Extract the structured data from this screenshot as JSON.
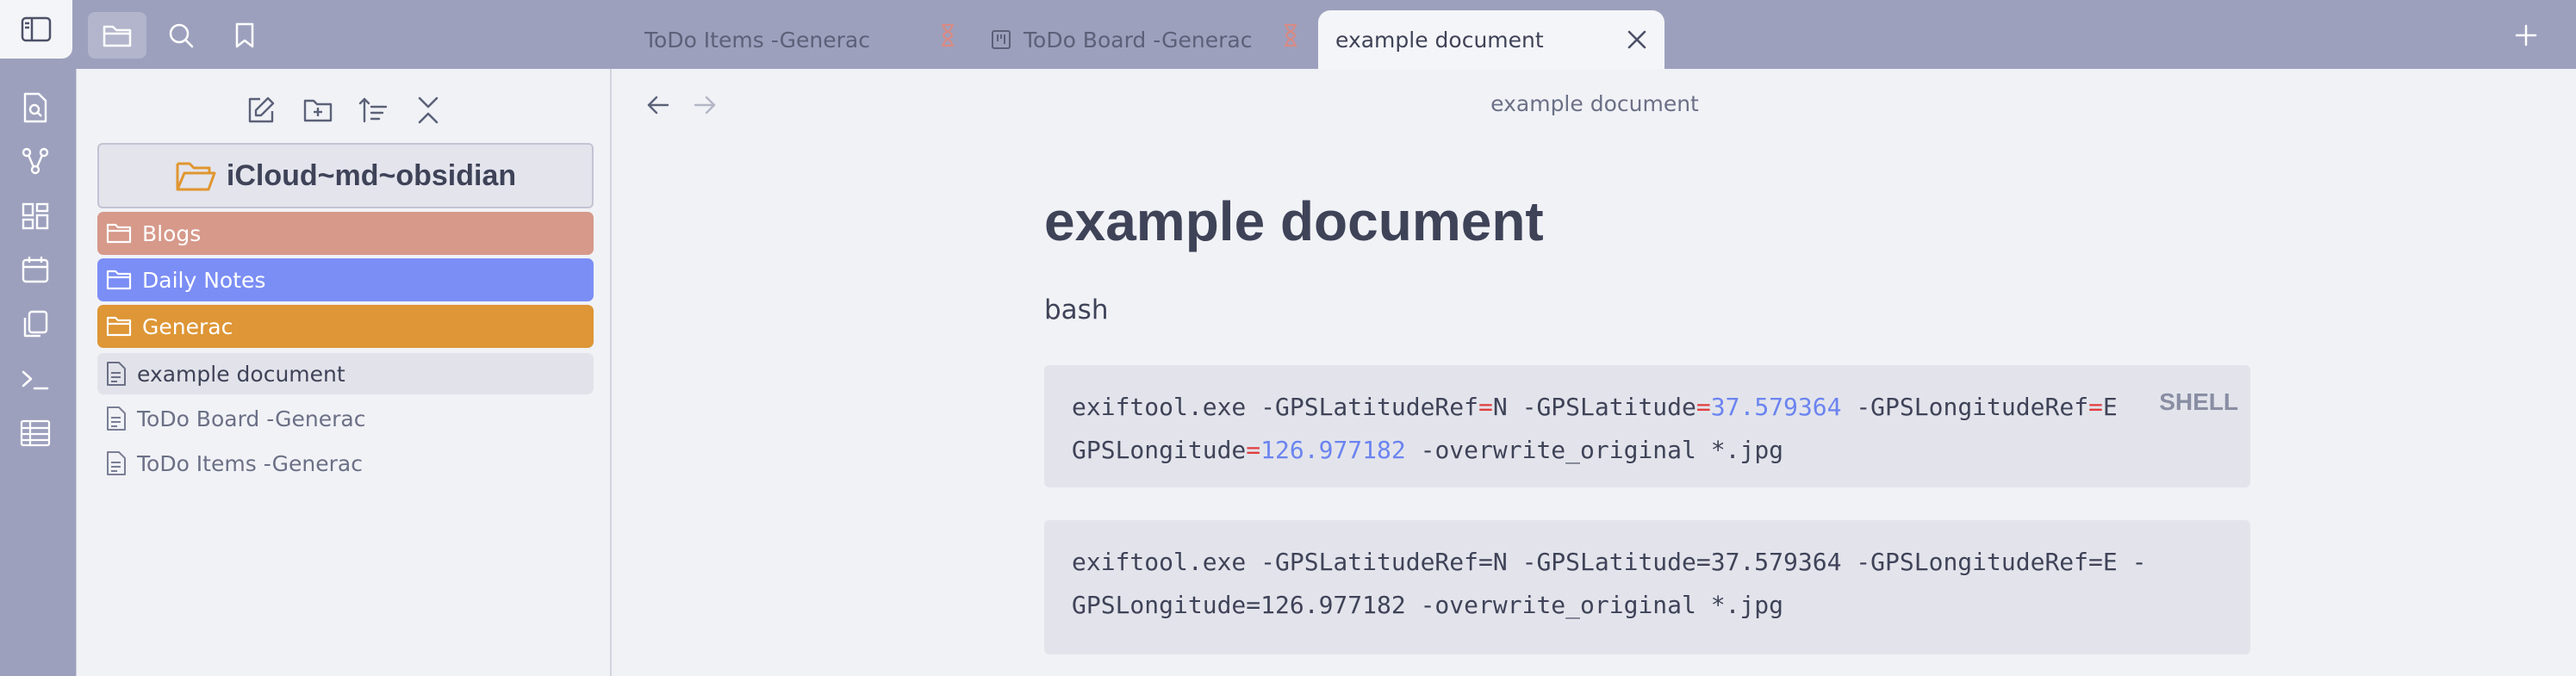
{
  "tabs": [
    {
      "label": "ToDo Items -Generac"
    },
    {
      "label": "ToDo Board -Generac"
    },
    {
      "label": "example document"
    }
  ],
  "icons": {
    "sidebar_toggle": "sidebar-left-icon",
    "files": "folder-icon",
    "search": "search-icon",
    "bookmarks": "bookmark-icon",
    "new_tab": "plus-icon",
    "close_tab": "close-icon"
  },
  "ribbon": [
    "file-search-icon",
    "graph-icon",
    "dashboard-icon",
    "calendar-icon",
    "copy-icon",
    "terminal-icon",
    "table-icon"
  ],
  "explorer": {
    "toolbar": [
      "new-note-icon",
      "new-folder-icon",
      "sort-icon",
      "collapse-icon"
    ],
    "vault_name": "iCloud~md~obsidian",
    "folders": [
      {
        "label": "Blogs",
        "color": "#d6998a"
      },
      {
        "label": "Daily Notes",
        "color": "#7b8ef5"
      },
      {
        "label": "Generac",
        "color": "#de9636"
      }
    ],
    "files": [
      {
        "label": "example document",
        "selected": true
      },
      {
        "label": "ToDo Board -Generac",
        "selected": false
      },
      {
        "label": "ToDo Items -Generac",
        "selected": false
      }
    ]
  },
  "main": {
    "view_title": "example document",
    "doc_title": "example document",
    "paragraph": "bash",
    "code_block_1": {
      "language_label": "SHELL",
      "line1_tokens": [
        {
          "t": "exiftool.exe -GPSLatitudeRef",
          "c": ""
        },
        {
          "t": "=",
          "c": "op"
        },
        {
          "t": "N -GPSLatitude",
          "c": ""
        },
        {
          "t": "=",
          "c": "op"
        },
        {
          "t": "37.579364",
          "c": "num"
        },
        {
          "t": " -GPSLongitudeRef",
          "c": ""
        },
        {
          "t": "=",
          "c": "op"
        },
        {
          "t": "E",
          "c": ""
        }
      ],
      "line2_tokens": [
        {
          "t": "GPSLongitude",
          "c": ""
        },
        {
          "t": "=",
          "c": "op"
        },
        {
          "t": "126.977182",
          "c": "num"
        },
        {
          "t": " -overwrite_original *.jpg",
          "c": ""
        }
      ]
    },
    "code_block_2": {
      "line1": "exiftool.exe -GPSLatitudeRef=N -GPSLatitude=37.579364 -GPSLongitudeRef=E -",
      "line2": "GPSLongitude=126.977182 -overwrite_original *.jpg"
    }
  },
  "colors": {
    "accent": "#7b8ef5",
    "titlebar": "#9da0bd",
    "background": "#f1f2f6"
  }
}
